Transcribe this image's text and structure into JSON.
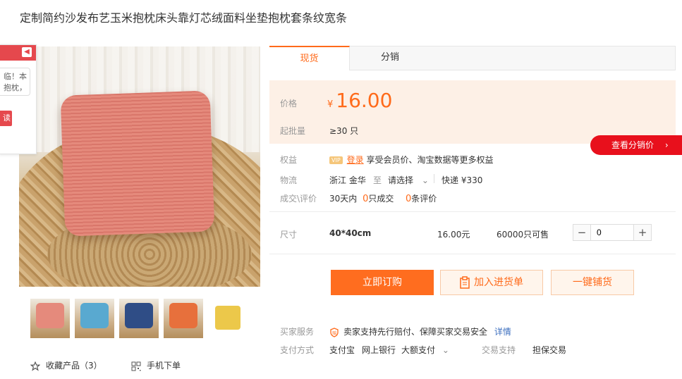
{
  "product": {
    "title": "定制简约沙发布艺玉米抱枕床头靠灯芯绒面料坐垫抱枕套条纹宽条"
  },
  "floating_panel": {
    "bubble_line1": "临！本",
    "bubble_line2": "抱枕，",
    "button": "读",
    "collapse_icon": "caret-left-icon"
  },
  "thumbnails": [
    {
      "pillow_color": "#e58a7c"
    },
    {
      "pillow_color": "#59a9d0"
    },
    {
      "pillow_color": "#2f4d86"
    },
    {
      "pillow_color": "#e7703c"
    },
    {
      "pillow_color": "#ecc84a"
    }
  ],
  "actions": {
    "favorite": "收藏产品（3）",
    "mobile_order": "手机下单"
  },
  "tabs": [
    {
      "label": "现货",
      "active": true
    },
    {
      "label": "分销",
      "active": false
    }
  ],
  "price": {
    "label": "价格",
    "currency": "¥",
    "value": "16.00"
  },
  "min_batch": {
    "label": "起批量",
    "value": "≥30 只"
  },
  "distribution_button": "查看分销价",
  "benefits": {
    "label": "权益",
    "vip_badge": "VIP",
    "login_link": "登录",
    "text": "享受会员价、淘宝数据等更多权益"
  },
  "logistics": {
    "label": "物流",
    "origin": "浙江 金华",
    "to": "至",
    "select": "请选择",
    "express": "快递 ¥330"
  },
  "deals": {
    "label": "成交\\评价",
    "prefix": "30天内",
    "deal_count": "0",
    "deal_suffix": "只成交",
    "review_count": "0",
    "review_suffix": "条评价"
  },
  "sku": {
    "label": "尺寸",
    "size": "40*40cm",
    "price": "16.00元",
    "stock": "60000只可售",
    "quantity": "0"
  },
  "buttons": {
    "buy": "立即订购",
    "add": "加入进货单",
    "one_click": "一键铺货"
  },
  "service": {
    "label": "买家服务",
    "text": "卖家支持先行赔付、保障买家交易安全",
    "detail_link": "详情"
  },
  "payment": {
    "label": "支付方式",
    "methods": [
      "支付宝",
      "网上银行",
      "大额支付"
    ],
    "trade_label": "交易支持",
    "trade_value": "担保交易"
  },
  "colors": {
    "accent": "#ff6a1a",
    "red": "#e8101c",
    "price_bg": "#fdf0e6"
  }
}
